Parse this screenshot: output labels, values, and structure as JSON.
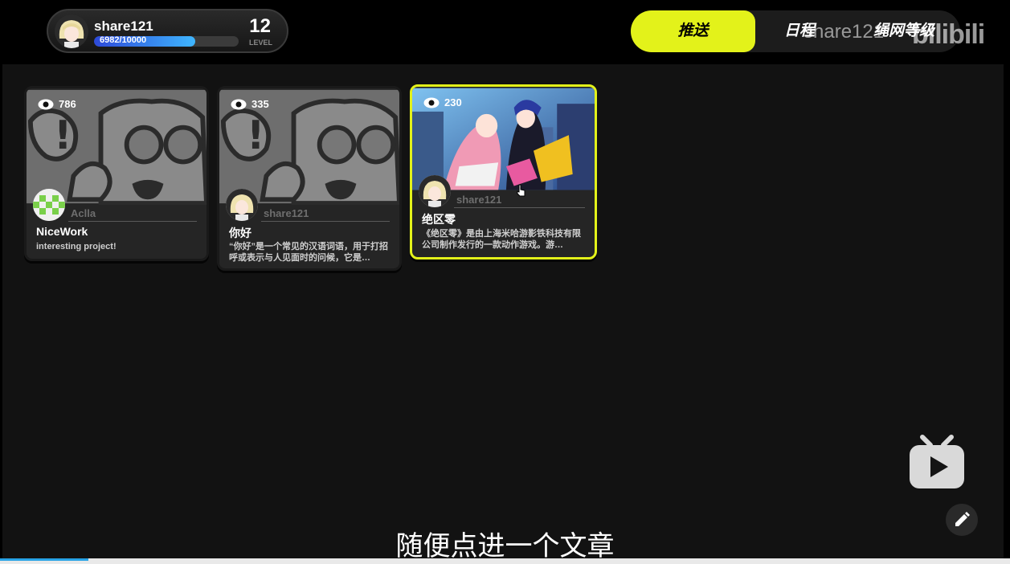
{
  "profile": {
    "username": "share121",
    "xp_text": "6982/10000",
    "xp_fraction": 0.6982,
    "level": "12",
    "level_label": "LEVEL"
  },
  "tabs": [
    {
      "label": "推送",
      "active": true
    },
    {
      "label": "日程",
      "active": false
    },
    {
      "label": "绳网等级",
      "active": false
    }
  ],
  "watermark": "share121",
  "brand": "bilibili",
  "cards": [
    {
      "views": "786",
      "author": "Aclla",
      "title": "NiceWork",
      "desc": "interesting project!"
    },
    {
      "views": "335",
      "author": "share121",
      "title": "你好",
      "desc": "“你好”是一个常见的汉语词语，用于打招呼或表示与人见面时的问候，它是…"
    },
    {
      "views": "230",
      "author": "share121",
      "title": "绝区零",
      "desc": "《绝区零》是由上海米哈游影铁科技有限公司制作发行的一款动作游戏。游…"
    }
  ],
  "subtitle": "随便点进一个文章",
  "colors": {
    "accent": "#e3f21a",
    "xp_bar": "#3fb6ff"
  }
}
